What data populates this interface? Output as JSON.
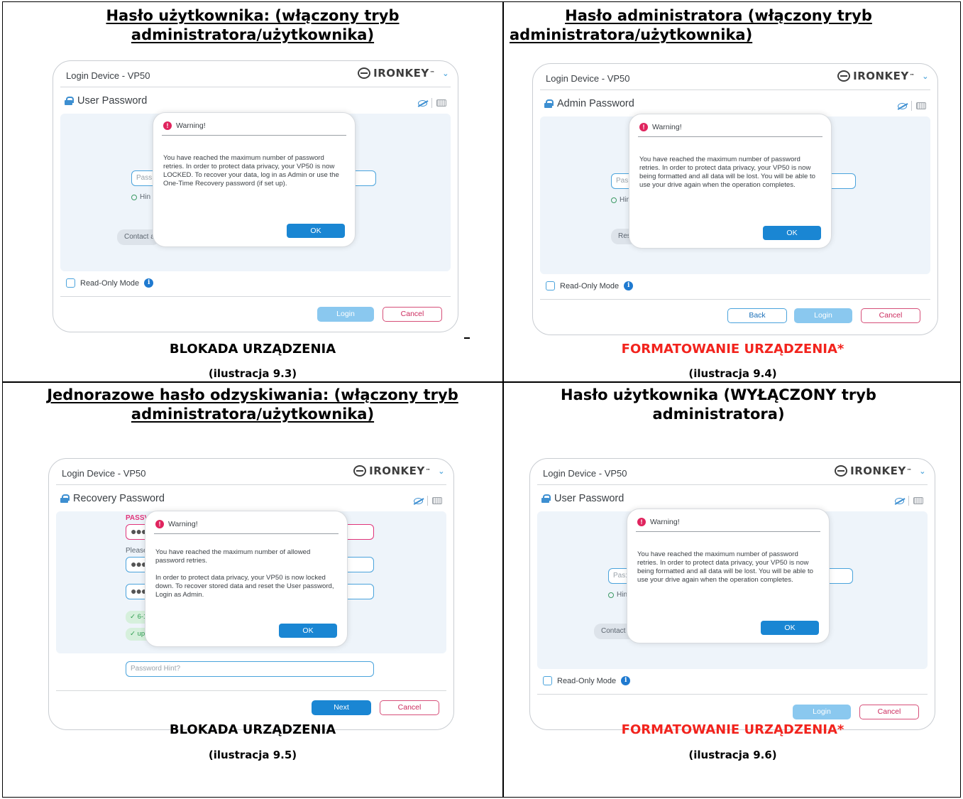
{
  "cells": [
    {
      "title": "Hasło użytkownika: (włączony tryb administratora/użytkownika)",
      "title_line1": "Hasło użytkownika: (włączony tryb",
      "title_line2": "administratora/użytkownika)",
      "window": {
        "title": "Login Device - VP50",
        "brand": "IRONKEY",
        "password_header": "User Password",
        "field_placeholder": "Pass",
        "hint_label": "Hin",
        "pill": "Contact a",
        "read_only": "Read-Only Mode",
        "buttons": [
          "Login",
          "Cancel"
        ]
      },
      "dialog": {
        "title": "Warning!",
        "body": [
          "You have reached the maximum number of password retries. In order to protect data privacy, your VP50 is now LOCKED. To recover your data, log in as Admin or use the One-Time Recovery password (if set up)."
        ],
        "ok": "OK"
      },
      "caption": "BLOKADA URZĄDZENIA",
      "figure": "(ilustracja 9.3)"
    },
    {
      "title": "Hasło administratora (włączony tryb administratora/użytkownika)",
      "title_line1": "Hasło administratora (włączony tryb",
      "title_line2": "administratora/użytkownika)",
      "window": {
        "title": "Login Device - VP50",
        "brand": "IRONKEY",
        "password_header": "Admin Password",
        "field_placeholder": "Pas:",
        "hint_label": "Hin",
        "pill": "Res",
        "read_only": "Read-Only Mode",
        "buttons": [
          "Back",
          "Login",
          "Cancel"
        ]
      },
      "dialog": {
        "title": "Warning!",
        "body": [
          "You have reached the maximum number of password retries. In order to protect data privacy, your VP50 is now being formatted and all data will be lost. You will be able to use your drive again when the operation completes."
        ],
        "ok": "OK"
      },
      "caption": "FORMATOWANIE URZĄDZENIA*",
      "figure": "(ilustracja 9.4)"
    },
    {
      "title": "Jednorazowe hasło odzyskiwania: (włączony tryb administratora/użytkownika)",
      "title_line1": "Jednorazowe hasło odzyskiwania: (włączony tryb",
      "title_line2": "administratora/użytkownika)",
      "window": {
        "title": "Login Device - VP50",
        "brand": "IRONKEY",
        "password_header": "Recovery Password",
        "pink_label": "PASSV",
        "please_label": "Please",
        "check1": "✓ 6-1",
        "check2": "✓ upp",
        "hint_field": "Password Hint?",
        "buttons": [
          "Next",
          "Cancel"
        ]
      },
      "dialog": {
        "title": "Warning!",
        "body": [
          "You have reached the maximum number of allowed password retries.",
          "In order to protect data privacy, your VP50 is now locked down. To recover stored data and reset the User password, Login as Admin."
        ],
        "ok": "OK"
      },
      "caption": "BLOKADA URZĄDZENIA",
      "figure": "(ilustracja 9.5)"
    },
    {
      "title": "Hasło użytkownika (WYŁĄCZONY tryb administratora)",
      "title_line1": "Hasło użytkownika (WYŁĄCZONY tryb",
      "title_line2": "administratora)",
      "window": {
        "title": "Login Device - VP50",
        "brand": "IRONKEY",
        "password_header": "User Password",
        "field_placeholder": "Pas:",
        "hint_label": "Hin",
        "pill": "Contact a",
        "read_only": "Read-Only Mode",
        "buttons": [
          "Login",
          "Cancel"
        ]
      },
      "dialog": {
        "title": "Warning!",
        "body": [
          "You have reached the maximum number of password retries. In order to protect data privacy, your VP50 is now being formatted and all data will be lost. You will be able to use your drive again when the operation completes."
        ],
        "ok": "OK"
      },
      "caption": "FORMATOWANIE URZĄDZENIA*",
      "figure": "(ilustracja 9.6)"
    }
  ],
  "colors": {
    "accent_blue": "#1a86d3",
    "warning_pink": "#e0245e",
    "caption_red": "#f2231d"
  },
  "icons": [
    "lock-icon",
    "eye-off-icon",
    "keyboard-icon",
    "warning-icon",
    "info-icon",
    "chevron-down-icon",
    "ironkey-logo"
  ]
}
